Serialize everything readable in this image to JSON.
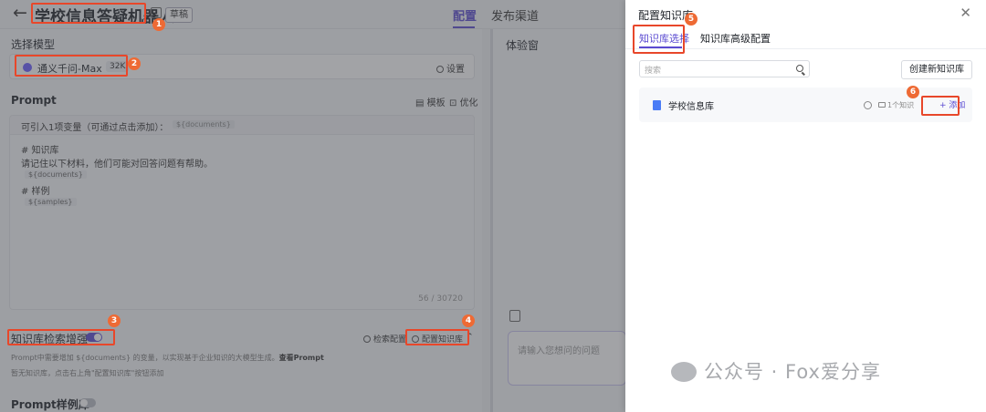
{
  "header": {
    "back_icon": "arrow-left-icon",
    "title": "学校信息答疑机器人",
    "draft_badge": "草稿",
    "tab_config": "配置",
    "tab_publish": "发布渠道"
  },
  "model": {
    "section_label": "选择模型",
    "name": "通义千问-Max",
    "context_tag": "32K",
    "settings_label": "设置"
  },
  "prompt": {
    "section_label": "Prompt",
    "template_label": "模板",
    "optimize_label": "优化",
    "variable_hint": "可引入1项变量（可通过点击添加）：",
    "variable_chip": "${documents}",
    "lines": [
      "# 知识库",
      "请记住以下材料，他们可能对回答问题有帮助。",
      "${documents}",
      "# 样例",
      "${samples}"
    ],
    "counter": "56 / 30720"
  },
  "kb_retrieval": {
    "label": "知识库检索增强",
    "enabled": true,
    "retrieval_config_label": "检索配置",
    "config_kb_label": "配置知识库",
    "hint_line1_prefix": "Prompt中需要增加 ${documents} 的变量，以实现基于企业知识的大模型生成。",
    "hint_line1_link": "查看Prompt",
    "hint_line2": "暂无知识库，点击右上角\"配置知识库\"按钮添加"
  },
  "samples": {
    "label": "Prompt样例库",
    "enabled": false
  },
  "experience": {
    "title": "体验窗",
    "input_placeholder": "请输入您想问的问题"
  },
  "drawer": {
    "title": "配置知识库",
    "close_icon": "close-icon",
    "tab_select": "知识库选择",
    "tab_advanced": "知识库高级配置",
    "search_placeholder": "搜索",
    "create_button": "创建新知识库",
    "kb_items": [
      {
        "name": "学校信息库",
        "meta": "1个知识",
        "add_label": "+ 添加"
      }
    ]
  },
  "annotations": [
    "1",
    "2",
    "3",
    "4",
    "5",
    "6"
  ],
  "watermark": "公众号 · Fox爱分享",
  "colors": {
    "accent": "#5a4ad1",
    "annotation_red": "#e8472a",
    "badge_orange": "#ee6a34",
    "overlay": "rgba(70,72,78,0.50)"
  }
}
